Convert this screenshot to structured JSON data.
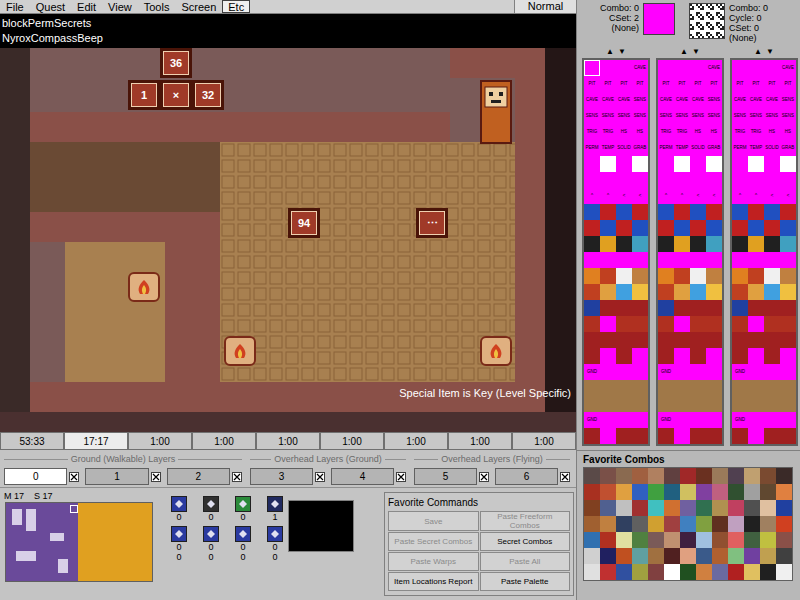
{
  "menu": [
    {
      "label": "File",
      "selected": false
    },
    {
      "label": "Quest",
      "selected": false
    },
    {
      "label": "Edit",
      "selected": false
    },
    {
      "label": "View",
      "selected": false
    },
    {
      "label": "Tools",
      "selected": false
    },
    {
      "label": "Screen",
      "selected": false
    },
    {
      "label": "Etc",
      "selected": true
    }
  ],
  "mode": "Normal",
  "map": {
    "overlay_lines": [
      "blockPermSecrets",
      "NyroxCompassBeep"
    ],
    "message": "Special Item is Key (Level Specific)",
    "blocks": [
      {
        "label": "36"
      },
      {
        "label": "1"
      },
      {
        "label": "×"
      },
      {
        "label": "32"
      },
      {
        "label": "94"
      },
      {
        "label": "⋯"
      }
    ]
  },
  "screen_tabs": [
    {
      "label": "53:33",
      "selected": false
    },
    {
      "label": "17:17",
      "selected": true
    },
    {
      "label": "1:00",
      "selected": false
    },
    {
      "label": "1:00",
      "selected": false
    },
    {
      "label": "1:00",
      "selected": false
    },
    {
      "label": "1:00",
      "selected": false
    },
    {
      "label": "1:00",
      "selected": false
    },
    {
      "label": "1:00",
      "selected": false
    },
    {
      "label": "1:00",
      "selected": false
    }
  ],
  "layer_groups": [
    {
      "title": "Ground (Walkable) Layers",
      "layers": [
        {
          "label": "0",
          "selected": true,
          "checked": true
        },
        {
          "label": "1",
          "selected": false,
          "checked": true
        },
        {
          "label": "2",
          "selected": false,
          "checked": true
        }
      ]
    },
    {
      "title": "Overhead Layers (Ground)",
      "layers": [
        {
          "label": "3",
          "selected": false,
          "checked": true
        },
        {
          "label": "4",
          "selected": false,
          "checked": true
        }
      ]
    },
    {
      "title": "Overhead Layers (Flying)",
      "layers": [
        {
          "label": "5",
          "selected": false,
          "checked": true
        },
        {
          "label": "6",
          "selected": false,
          "checked": true
        }
      ]
    }
  ],
  "minimap": {
    "map": "M 17",
    "screen": "S 17"
  },
  "items": [
    {
      "values": [
        "0"
      ]
    },
    {
      "values": [
        "0"
      ]
    },
    {
      "values": [
        "0"
      ]
    },
    {
      "values": [
        "1"
      ]
    },
    {
      "values": [
        "0",
        "0"
      ]
    },
    {
      "values": [
        "0",
        "0"
      ]
    },
    {
      "values": [
        "0",
        "0"
      ]
    },
    {
      "values": [
        "0",
        "0"
      ]
    }
  ],
  "favorite_commands": {
    "title": "Favorite Commands",
    "buttons": [
      {
        "label": "Save",
        "disabled": true
      },
      {
        "label": "Paste Freeform Combos",
        "disabled": true
      },
      {
        "label": "Paste Secret Combos",
        "disabled": true
      },
      {
        "label": "Secret Combos",
        "disabled": false
      },
      {
        "label": "Paste Warps",
        "disabled": true
      },
      {
        "label": "Paste All",
        "disabled": true
      },
      {
        "label": "Item Locations Report",
        "disabled": false
      },
      {
        "label": "Paste Palette",
        "disabled": false
      }
    ]
  },
  "current_combo": {
    "lines": [
      "Combo: 0",
      "CSet: 2",
      "(None)"
    ],
    "color": "#ff00ff"
  },
  "cycle_combo": {
    "lines": [
      "Combo: 0",
      "Cycle: 0",
      "CSet: 0",
      "(None)"
    ]
  },
  "combo_columns": [
    {
      "arrows": [
        "▲",
        "▼"
      ],
      "highlighted": true
    },
    {
      "arrows": [
        "▲",
        "▼"
      ],
      "highlighted": false
    },
    {
      "arrows": [
        "▲",
        "▼"
      ],
      "highlighted": false
    }
  ],
  "combo_rows": [
    {
      "labels": [
        "",
        "",
        "",
        "CAVE"
      ],
      "colors": [
        "#ff00ff",
        "#ff00ff",
        "#ff00ff",
        "#ff00ff"
      ]
    },
    {
      "labels": [
        "PIT",
        "PIT",
        "PIT",
        "PIT"
      ],
      "colors": [
        "#ff00ff",
        "#ff00ff",
        "#ff00ff",
        "#ff00ff"
      ]
    },
    {
      "labels": [
        "CAVE",
        "CAVE",
        "CAVE",
        "SENS"
      ],
      "colors": [
        "#ff00ff",
        "#ff00ff",
        "#ff00ff",
        "#ff00ff"
      ]
    },
    {
      "labels": [
        "SENS",
        "SENS",
        "SENS",
        "SENS"
      ],
      "colors": [
        "#ff00ff",
        "#ff00ff",
        "#ff00ff",
        "#ff00ff"
      ]
    },
    {
      "labels": [
        "TRIG",
        "TRIG",
        "HS",
        "HS"
      ],
      "colors": [
        "#ff00ff",
        "#ff00ff",
        "#ff00ff",
        "#ff00ff"
      ]
    },
    {
      "labels": [
        "PERM",
        "TEMP",
        "SOLID",
        "GRAB"
      ],
      "colors": [
        "#ff00ff",
        "#ff00ff",
        "#ff00ff",
        "#ff00ff"
      ]
    },
    {
      "labels": [
        "",
        "",
        "",
        ""
      ],
      "colors": [
        "#ff00ff",
        "#ffffff",
        "#ff00ff",
        "#ffffff"
      ]
    },
    {
      "labels": [
        "",
        "",
        "",
        ""
      ],
      "colors": [
        "#ff00ff",
        "#ff00ff",
        "#ff00ff",
        "#ff00ff"
      ]
    },
    {
      "labels": [
        "^",
        "^",
        "<",
        "<"
      ],
      "colors": [
        "#ff00ff",
        "#ff00ff",
        "#ff00ff",
        "#ff00ff"
      ]
    },
    {
      "labels": [
        "",
        "",
        "",
        ""
      ],
      "colors": [
        "#2050c0",
        "#c02020",
        "#2050c0",
        "#c02020"
      ]
    },
    {
      "labels": [
        "",
        "",
        "",
        ""
      ],
      "colors": [
        "#c02020",
        "#2050c0",
        "#c02020",
        "#2050c0"
      ]
    },
    {
      "labels": [
        "",
        "",
        "",
        ""
      ],
      "colors": [
        "#202020",
        "#e0a020",
        "#202020",
        "#40a0c0"
      ]
    },
    {
      "labels": [
        "",
        "",
        "",
        ""
      ],
      "colors": [
        "#ff00ff",
        "#ff00ff",
        "#ff00ff",
        "#ff00ff"
      ]
    },
    {
      "labels": [
        "",
        "",
        "",
        ""
      ],
      "colors": [
        "#e08020",
        "#c04020",
        "#f0f0f0",
        "#c08040"
      ]
    },
    {
      "labels": [
        "",
        "",
        "",
        ""
      ],
      "colors": [
        "#c04020",
        "#e0a040",
        "#40a0e0",
        "#f0c040"
      ]
    },
    {
      "labels": [
        "",
        "",
        "",
        ""
      ],
      "colors": [
        "#2040a0",
        "#a02020",
        "#a02020",
        "#a02020"
      ]
    },
    {
      "labels": [
        "",
        "",
        "",
        ""
      ],
      "colors": [
        "#b03020",
        "#ff00ff",
        "#b03020",
        "#b03020"
      ]
    },
    {
      "labels": [
        "",
        "",
        "",
        ""
      ],
      "colors": [
        "#a02020",
        "#a02020",
        "#a02020",
        "#a02020"
      ]
    },
    {
      "labels": [
        "",
        "",
        "",
        ""
      ],
      "colors": [
        "#a02020",
        "#ff00ff",
        "#a02020",
        "#ff00ff"
      ]
    },
    {
      "labels": [
        "GND",
        "",
        "",
        ""
      ],
      "colors": [
        "#ff00ff",
        "#ff00ff",
        "#ff00ff",
        "#ff00ff"
      ]
    },
    {
      "labels": [
        "",
        "",
        "",
        ""
      ],
      "colors": [
        "#a07848",
        "#a07848",
        "#a07848",
        "#a07848"
      ]
    },
    {
      "labels": [
        "",
        "",
        "",
        ""
      ],
      "colors": [
        "#a07848",
        "#a07848",
        "#a07848",
        "#a07848"
      ]
    },
    {
      "labels": [
        "GND",
        "",
        "",
        ""
      ],
      "colors": [
        "#ff00ff",
        "#ff00ff",
        "#ff00ff",
        "#ff00ff"
      ]
    },
    {
      "labels": [
        "",
        "",
        "",
        ""
      ],
      "colors": [
        "#a02020",
        "#ff00ff",
        "#a02020",
        "#a02020"
      ]
    }
  ],
  "favorite_combos": {
    "title": "Favorite Combos",
    "colors": [
      "#5a4a48",
      "#7a5048",
      "#8a6a50",
      "#a06040",
      "#b08060",
      "#604040",
      "#a02828",
      "#6a3020",
      "#9a7a5a",
      "#504050",
      "#c0a070",
      "#7a4a30",
      "#3a2a28",
      "#a83020",
      "#c05030",
      "#e0a040",
      "#3060c0",
      "#40a040",
      "#206080",
      "#d0c060",
      "#8040a0",
      "#c06080",
      "#305030",
      "#a0a0a0",
      "#604830",
      "#e08040",
      "#804020",
      "#506090",
      "#c0c0c0",
      "#a03030",
      "#40c0c0",
      "#d07030",
      "#7060a0",
      "#307050",
      "#b09050",
      "#c04060",
      "#505050",
      "#e0c0a0",
      "#2040a0",
      "#a06030",
      "#c08040",
      "#304060",
      "#606060",
      "#d0a030",
      "#a04040",
      "#4080c0",
      "#80a040",
      "#603020",
      "#c0a0c0",
      "#202020",
      "#a08060",
      "#d04020",
      "#3070b0",
      "#b03020",
      "#e0e0a0",
      "#508040",
      "#7a5a58",
      "#c09070",
      "#402040",
      "#a0c0e0",
      "#905030",
      "#e06060",
      "#406040",
      "#c0c040",
      "#8a5048",
      "#d0d0d0",
      "#202060",
      "#c05020",
      "#60a0a0",
      "#a07040",
      "#502020",
      "#e0a080",
      "#3a5a8a",
      "#b06030",
      "#80c080",
      "#7040a0",
      "#c0a050",
      "#404040",
      "#e0e0e0",
      "#c03030",
      "#3050a0",
      "#a0a040",
      "#804040",
      "#ffffff",
      "#205020",
      "#d08040",
      "#6a6aa0",
      "#b02020",
      "#e0c060",
      "#202020",
      "#f0f0f0"
    ]
  }
}
